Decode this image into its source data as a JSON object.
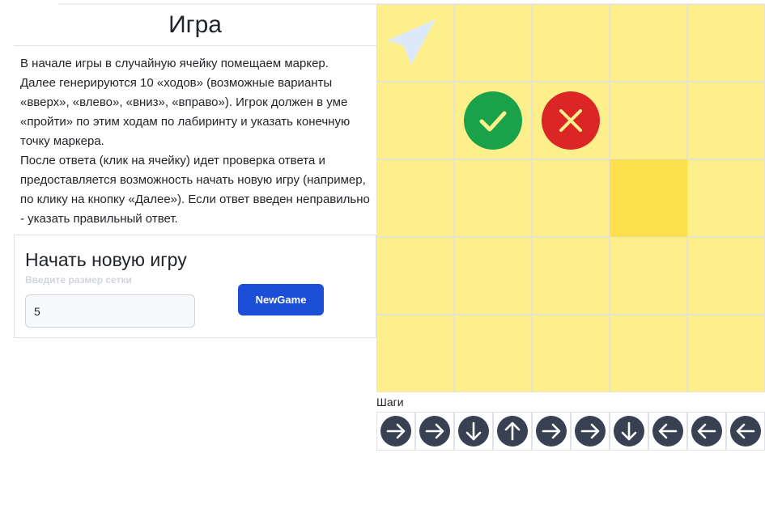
{
  "title": "Игра",
  "description": [
    "В начале игры в случайную ячейку помещаем маркер.",
    "Далее генерируются 10 «ходов» (возможные варианты «вверх», «влево», «вниз», «вправо»). Игрок должен в уме «пройти» по этим ходам по лабиринту и указать конечную точку маркера.",
    "После ответа (клик на ячейку) идет проверка ответа и предоставляется возможность начать новую игру (например, по клику на кнопку «Далее»). Если ответ введен неправильно - указать правильный ответ."
  ],
  "new_game": {
    "title": "Начать новую игру",
    "hint": "Введите размер сетки",
    "size_value": "5",
    "button_label": "NewGame"
  },
  "grid": {
    "size": 5,
    "cells": [
      [
        "pointer",
        "",
        "",
        "",
        ""
      ],
      [
        "",
        "correct",
        "wrong",
        "",
        ""
      ],
      [
        "",
        "",
        "",
        "marker",
        ""
      ],
      [
        "",
        "",
        "",
        "",
        ""
      ],
      [
        "",
        "",
        "",
        "",
        ""
      ]
    ]
  },
  "steps": {
    "label": "Шаги",
    "moves": [
      "right",
      "right",
      "down",
      "up",
      "right",
      "right",
      "down",
      "left",
      "left",
      "left"
    ]
  },
  "colors": {
    "cell": "#fdf08c",
    "marker": "#fde04b",
    "correct": "#1aa24a",
    "wrong": "#dc2626",
    "button": "#1d4ed8",
    "step_icon": "#374151"
  }
}
